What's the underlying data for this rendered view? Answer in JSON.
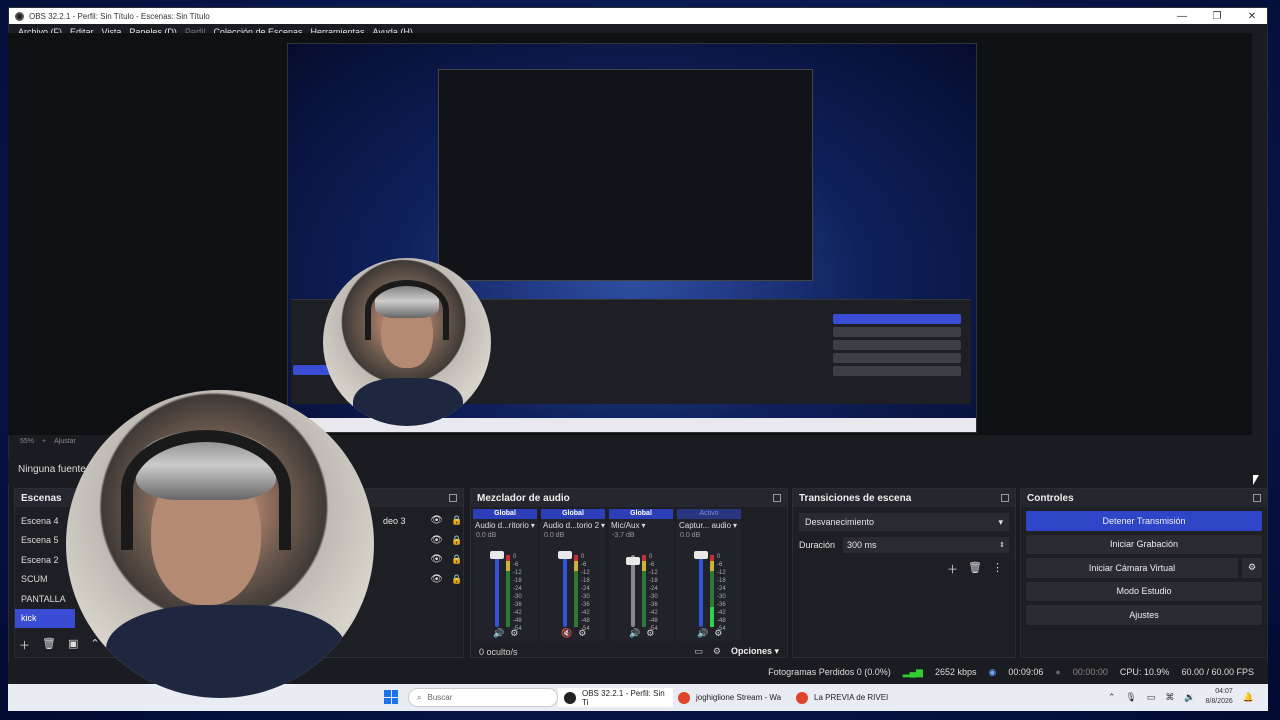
{
  "window": {
    "title": "OBS 32.2.1 - Perfil: Sin Título - Escenas: Sin Título",
    "minimize": "—",
    "maximize": "❐",
    "close": "✕"
  },
  "menu": {
    "items": [
      "Archivo (F)",
      "Editar",
      "Vista",
      "Paneles (D)",
      "Perfil",
      "Colección de Escenas",
      "Herramientas",
      "Ayuda (H)"
    ]
  },
  "preview": {
    "zoom": "55%",
    "zoom_plus": "+",
    "fit_label": "Ajustar"
  },
  "source_bar": {
    "text": "Ninguna fuente s"
  },
  "scenes": {
    "title": "Escenas",
    "items": [
      {
        "label": "Escena 4",
        "active": false
      },
      {
        "label": "Escena 5",
        "active": false
      },
      {
        "label": "Escena 2",
        "active": false
      },
      {
        "label": "SCUM",
        "active": false
      },
      {
        "label": "PANTALLA",
        "active": false
      },
      {
        "label": "kick",
        "active": true
      }
    ]
  },
  "sources": {
    "items": [
      {
        "label": "deo 3"
      },
      {
        "label": ""
      },
      {
        "label": ""
      },
      {
        "label": ""
      }
    ]
  },
  "mixer": {
    "title": "Mezclador de audio",
    "channels": [
      {
        "tag": "Global",
        "name": "Audio d...ritorio",
        "db": "0.0 dB",
        "level": 0,
        "muted": false
      },
      {
        "tag": "Global",
        "name": "Audio d...torio 2",
        "db": "0.0 dB",
        "level": 0,
        "muted": true
      },
      {
        "tag": "Global",
        "name": "Mic/Aux",
        "db": "-3.7 dB",
        "level": 0,
        "muted": false
      },
      {
        "tag": "Activo",
        "name": "Captur... audio",
        "db": "0.0 dB",
        "level": 0.28,
        "muted": false
      }
    ],
    "scale": [
      "0",
      "-6",
      "-12",
      "-18",
      "-24",
      "-30",
      "-36",
      "-42",
      "-48",
      "-54",
      "-60"
    ],
    "hidden_count": "0 oculto/s",
    "options_label": "Opciones"
  },
  "transitions": {
    "title": "Transiciones de escena",
    "selected": "Desvanecimiento",
    "duration_label": "Duración",
    "duration_value": "300 ms"
  },
  "controls": {
    "title": "Controles",
    "stop_stream": "Detener Transmisión",
    "start_recording": "Iniciar Grabación",
    "start_virtual_cam": "Iniciar Cámara Virtual",
    "studio_mode": "Modo Estudio",
    "settings": "Ajustes"
  },
  "status": {
    "dropped_frames": "Fotogramas Perdidos 0 (0.0%)",
    "bitrate": "2652 kbps",
    "stream_time": "00:09:06",
    "rec_time": "00:00:00",
    "cpu": "CPU: 10.9%",
    "fps": "60.00 / 60.00 FPS"
  },
  "taskbar": {
    "search_placeholder": "Buscar",
    "apps": [
      {
        "label": "OBS 32.2.1 - Perfil: Sin Ti",
        "color": "#222222"
      },
      {
        "label": "joghiglione Stream - Wa",
        "color": "#e0452c"
      },
      {
        "label": "La PREVIA de RIVEI",
        "color": "#e0452c"
      }
    ],
    "time": "04:07",
    "date": "8/8/2026"
  },
  "colors": {
    "accent": "#2f45c8",
    "active_scene": "#3a4bd4",
    "meter_green": "#31d04a"
  }
}
